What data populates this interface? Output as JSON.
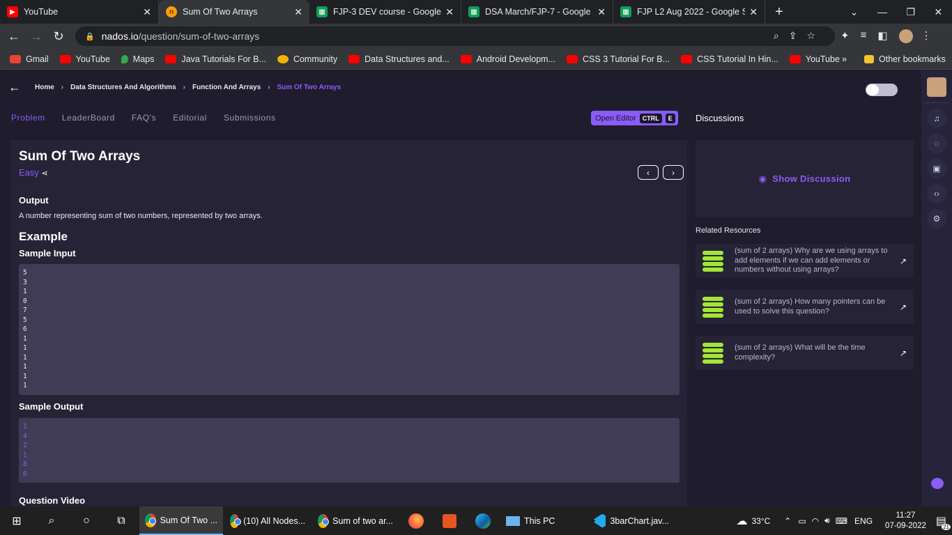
{
  "browser": {
    "tabs": [
      {
        "title": "YouTube",
        "icon": "youtube-icon",
        "active": false
      },
      {
        "title": "Sum Of Two Arrays",
        "icon": "nados-icon",
        "active": true
      },
      {
        "title": "FJP-3 DEV course - Google Sl",
        "icon": "google-sheets-icon",
        "active": false
      },
      {
        "title": "DSA March/FJP-7 - Google S",
        "icon": "google-sheets-icon",
        "active": false
      },
      {
        "title": "FJP L2 Aug 2022 - Google Sh",
        "icon": "google-sheets-icon",
        "active": false
      }
    ],
    "url_domain": "nados.io",
    "url_path": "/question/sum-of-two-arrays",
    "bookmarks": [
      {
        "label": "Gmail",
        "color": "#ea4335"
      },
      {
        "label": "YouTube",
        "color": "#ff0000"
      },
      {
        "label": "Maps",
        "color": "#34a853"
      },
      {
        "label": "Java Tutorials For B...",
        "color": "#ff0000"
      },
      {
        "label": "Community",
        "color": "#f4b400"
      },
      {
        "label": "Data Structures and...",
        "color": "#ff0000"
      },
      {
        "label": "Android Developm...",
        "color": "#ff0000"
      },
      {
        "label": "CSS 3 Tutorial For B...",
        "color": "#ff0000"
      },
      {
        "label": "CSS Tutorial In Hin...",
        "color": "#ff0000"
      },
      {
        "label": "YouTube",
        "color": "#ff0000"
      }
    ],
    "bookmarks_overflow": "»",
    "other_bookmarks": "Other bookmarks"
  },
  "breadcrumb": [
    "Home",
    "Data Structures And Algorithms",
    "Function And Arrays",
    "Sum Of Two Arrays"
  ],
  "subnav": [
    "Problem",
    "LeaderBoard",
    "FAQ's",
    "Editorial",
    "Submissions"
  ],
  "open_editor": {
    "label": "Open Editor",
    "key1": "CTRL",
    "key2": "E"
  },
  "discussions_title": "Discussions",
  "problem": {
    "title": "Sum Of Two Arrays",
    "difficulty": "Easy",
    "output_heading": "Output",
    "output_text": "A number representing sum of two numbers, represented by two arrays.",
    "example_heading": "Example",
    "sample_input_heading": "Sample Input",
    "sample_input": [
      "5",
      "3",
      "1",
      "0",
      "7",
      "5",
      "6",
      "1",
      "1",
      "1",
      "1",
      "1",
      "1"
    ],
    "sample_output_heading": "Sample Output",
    "sample_output": [
      "1",
      "4",
      "2",
      "1",
      "8",
      "6"
    ],
    "video_heading": "Question Video"
  },
  "show_discussion": "Show Discussion",
  "related_title": "Related Resources",
  "related": [
    "(sum of 2 arrays) Why are we using arrays to add elements if we can add elements or numbers without using arrays?",
    "(sum of 2 arrays) How many pointers can be used to solve this question?",
    "(sum of 2 arrays) What will be the time complexity?"
  ],
  "taskbar": {
    "items": [
      {
        "label": "Sum Of Two ...",
        "active": true
      },
      {
        "label": "(10) All Nodes..."
      },
      {
        "label": "Sum of two ar..."
      },
      {
        "label": ""
      },
      {
        "label": ""
      },
      {
        "label": ""
      },
      {
        "label": "This PC"
      },
      {
        "label": "3barChart.jav..."
      }
    ],
    "weather": "33°C",
    "lang": "ENG",
    "time": "11:27",
    "date": "07-09-2022",
    "notif": "21"
  }
}
